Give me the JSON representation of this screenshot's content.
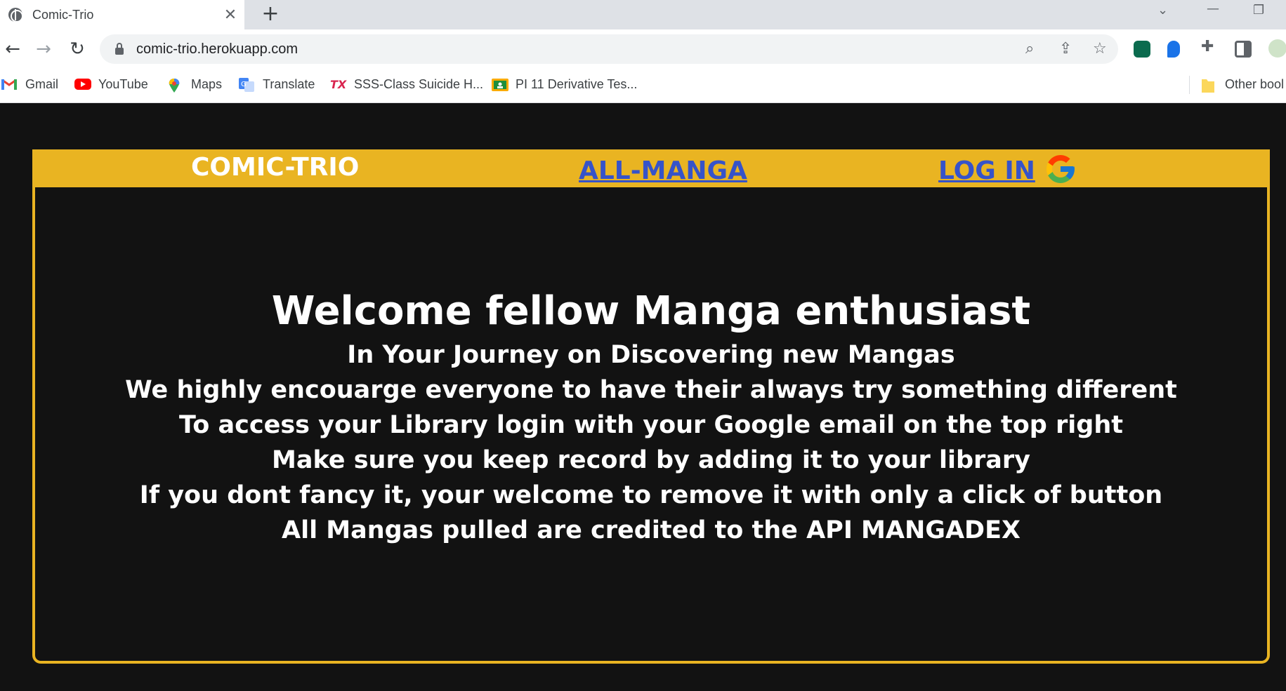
{
  "browser": {
    "tab_title": "Comic-Trio",
    "tab_close": "✕",
    "new_tab": "+",
    "url": "comic-trio.herokuapp.com",
    "bookmarks": [
      {
        "label": "Gmail",
        "icon": "gmail-icon"
      },
      {
        "label": "YouTube",
        "icon": "youtube-icon"
      },
      {
        "label": "Maps",
        "icon": "maps-icon"
      },
      {
        "label": "Translate",
        "icon": "translate-icon"
      },
      {
        "label": "SSS-Class Suicide H...",
        "icon": "tx-icon"
      },
      {
        "label": "PI 11 Derivative Tes...",
        "icon": "classroom-icon"
      }
    ],
    "other_bookmarks": "Other bool"
  },
  "nav": {
    "brand": "COMIC-TRIO",
    "all_manga": "ALL-MANGA",
    "login": "LOG IN"
  },
  "main": {
    "heading": "Welcome fellow Manga enthusiast",
    "lines": [
      "In Your Journey on Discovering new Mangas",
      "We highly encouarge everyone to have their always try something different",
      "To access your Library login with your Google email on the top right",
      "Make sure you keep record by adding it to your library",
      "If you dont fancy it, your welcome to remove it with only a click of button",
      "All Mangas pulled are credited to the API MANGADEX"
    ]
  },
  "colors": {
    "accent": "#e9b422",
    "link": "#3653c9",
    "background": "#121212",
    "text": "#ffffff"
  }
}
